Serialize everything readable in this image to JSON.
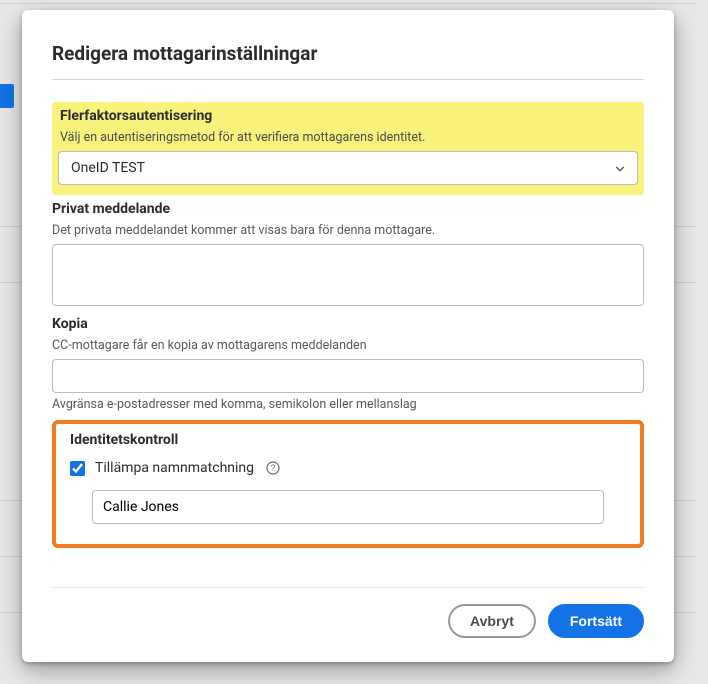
{
  "dialog": {
    "title": "Redigera mottagarinställningar",
    "mfa": {
      "section_title": "Flerfaktorsautentisering",
      "hint": "Välj en autentiseringsmetod för att verifiera mottagarens identitet.",
      "selected": "OneID TEST"
    },
    "private_message": {
      "section_title": "Privat meddelande",
      "hint": "Det privata meddelandet kommer att visas bara för denna mottagare.",
      "value": ""
    },
    "cc": {
      "section_title": "Kopia",
      "hint": "CC-mottagare får en kopia av mottagarens meddelanden",
      "value": "",
      "help_below": "Avgränsa e-postadresser med komma, semikolon eller mellanslag"
    },
    "identity": {
      "section_title": "Identitetskontroll",
      "apply_name_match_checked": true,
      "apply_name_match_label": "Tillämpa namnmatchning",
      "name_value": "Callie Jones"
    },
    "buttons": {
      "cancel": "Avbryt",
      "continue": "Fortsätt"
    }
  }
}
